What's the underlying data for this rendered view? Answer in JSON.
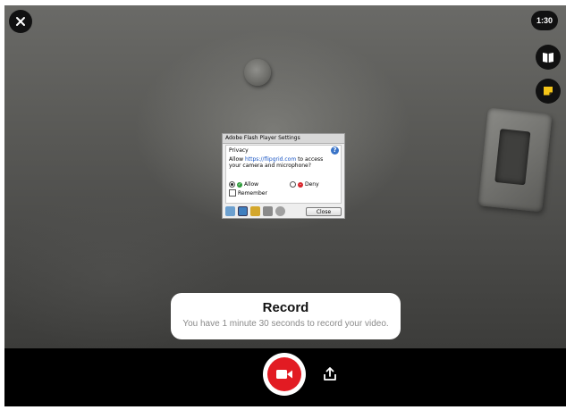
{
  "timer": {
    "label": "1:30"
  },
  "flash_dialog": {
    "title": "Adobe Flash Player Settings",
    "section": "Privacy",
    "help_icon": "?",
    "message_prefix": "Allow ",
    "message_link": "https://flipgrid.com",
    "message_suffix": " to access your camera and microphone?",
    "allow_label": "Allow",
    "deny_label": "Deny",
    "remember_label": "Remember",
    "selected": "Allow",
    "close_label": "Close"
  },
  "record_tooltip": {
    "title": "Record",
    "subtitle": "You have 1 minute 30 seconds to record your video."
  },
  "colors": {
    "record_red": "#e21b23",
    "bar_black": "#000000",
    "link_blue": "#1a56c4"
  },
  "icons": [
    "close-icon",
    "book-icon",
    "sticky-note-icon",
    "video-camera-icon",
    "upload-icon"
  ]
}
